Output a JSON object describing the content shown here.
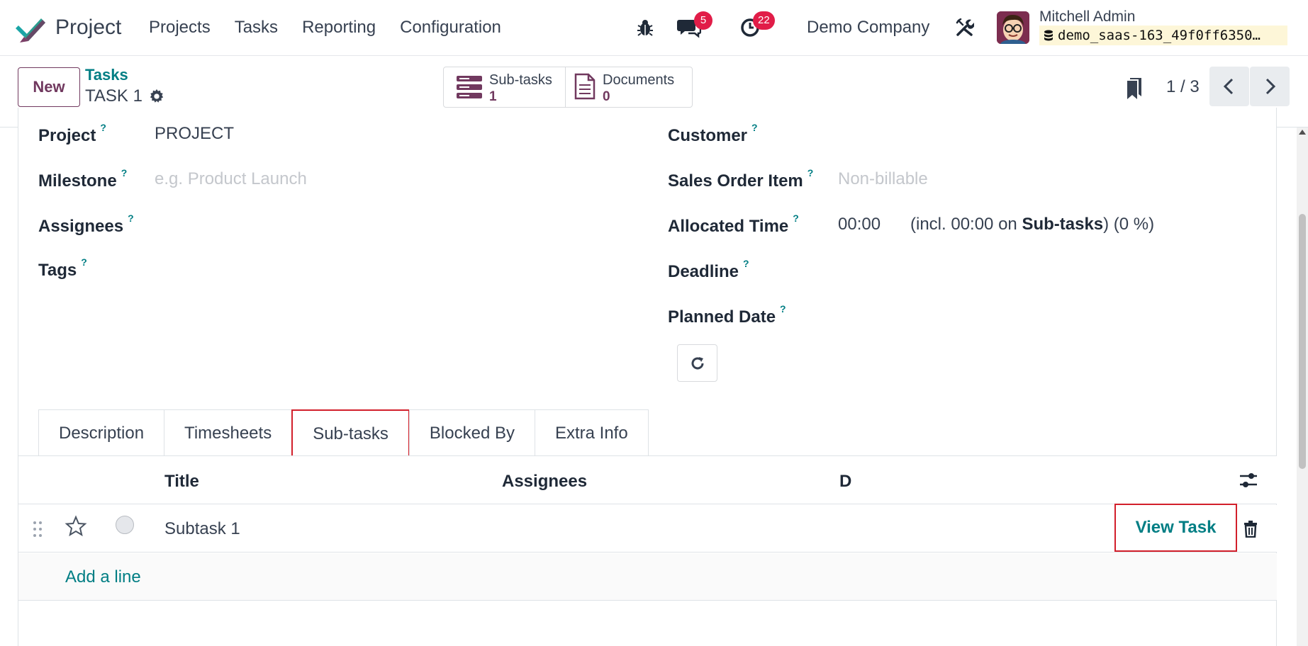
{
  "navbar": {
    "app_name": "Project",
    "menu": [
      "Projects",
      "Tasks",
      "Reporting",
      "Configuration"
    ],
    "messages_count": "5",
    "activities_count": "22",
    "company": "Demo Company",
    "user_name": "Mitchell Admin",
    "database": "demo_saas-163_49f0ff6350…"
  },
  "control": {
    "new_label": "New",
    "breadcrumb_parent": "Tasks",
    "breadcrumb_current": "TASK 1",
    "smart_buttons": {
      "subtasks_label": "Sub-tasks",
      "subtasks_value": "1",
      "documents_label": "Documents",
      "documents_value": "0"
    },
    "pager": "1 / 3"
  },
  "form": {
    "project_label": "Project",
    "project_value": "PROJECT",
    "milestone_label": "Milestone",
    "milestone_placeholder": "e.g. Product Launch",
    "assignees_label": "Assignees",
    "tags_label": "Tags",
    "customer_label": "Customer",
    "sales_order_item_label": "Sales Order Item",
    "sales_order_item_placeholder": "Non-billable",
    "allocated_time_label": "Allocated Time",
    "allocated_time_value": "00:00",
    "allocated_incl_prefix": "(incl. 00:00 on ",
    "allocated_incl_bold": "Sub-tasks",
    "allocated_incl_suffix": ") (0 %)",
    "deadline_label": "Deadline",
    "planned_date_label": "Planned Date",
    "help_mark": "?"
  },
  "tabs": [
    "Description",
    "Timesheets",
    "Sub-tasks",
    "Blocked By",
    "Extra Info"
  ],
  "subtasks_table": {
    "headers": {
      "title": "Title",
      "assignees": "Assignees",
      "deadline": "D"
    },
    "rows": [
      {
        "title": "Subtask 1",
        "action": "View Task"
      }
    ],
    "add_line": "Add a line"
  },
  "colors": {
    "brand": "#71395f",
    "link": "#017e84",
    "highlight": "#d21f2b",
    "badge": "#e11d48"
  }
}
